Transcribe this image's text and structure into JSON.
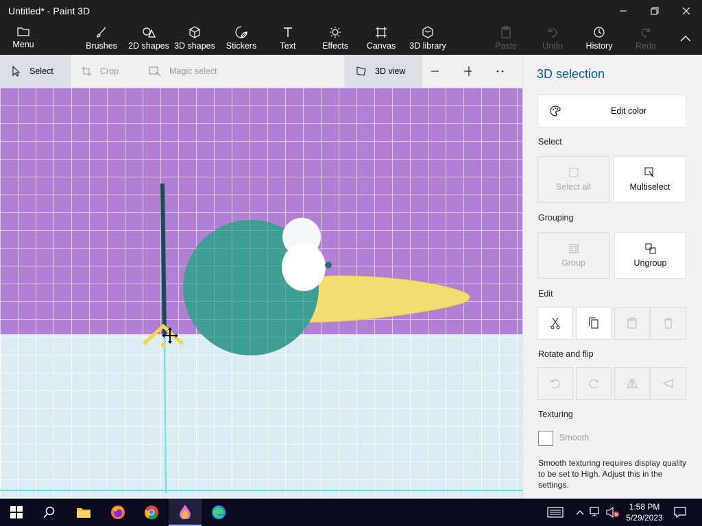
{
  "window": {
    "title": "Untitled* - Paint 3D"
  },
  "ribbon": {
    "menu": "Menu",
    "brushes": "Brushes",
    "shapes2d": "2D shapes",
    "shapes3d": "3D shapes",
    "stickers": "Stickers",
    "text": "Text",
    "effects": "Effects",
    "canvas": "Canvas",
    "library3d": "3D library",
    "paste": "Paste",
    "undo": "Undo",
    "history": "History",
    "redo": "Redo"
  },
  "toolbar": {
    "select": "Select",
    "crop": "Crop",
    "magic_select": "Magic select",
    "view3d": "3D view"
  },
  "panel": {
    "title": "3D selection",
    "edit_color": "Edit color",
    "select_section": "Select",
    "select_all": "Select all",
    "multiselect": "Multiselect",
    "grouping_section": "Grouping",
    "group": "Group",
    "ungroup": "Ungroup",
    "edit_section": "Edit",
    "rotate_section": "Rotate and flip",
    "texturing_section": "Texturing",
    "smooth": "Smooth",
    "note": "Smooth texturing requires display quality to be set to High. Adjust this in the settings."
  },
  "taskbar": {
    "time": "1:58 PM",
    "date": "5/29/2023"
  },
  "colors": {
    "wall": "#b07fd6",
    "floor": "#dcedf4",
    "sphere": "#3f9e93",
    "cone": "#f3dd73",
    "accent": "#0b5aa8"
  }
}
